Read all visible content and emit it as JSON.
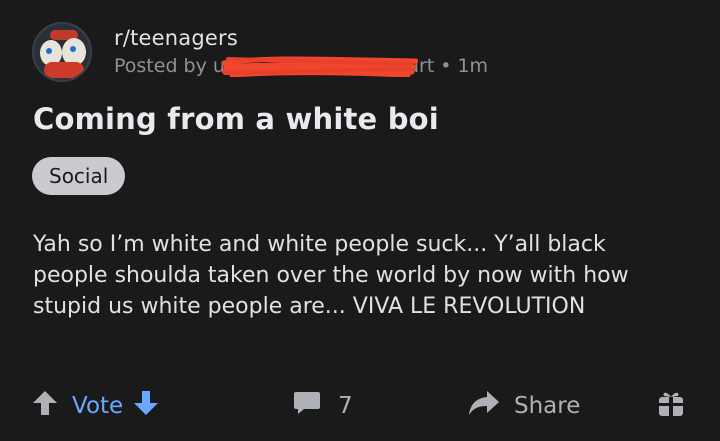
{
  "post": {
    "subreddit": "r/teenagers",
    "posted_prefix": "Posted by u/",
    "posted_suffix": "art",
    "dot": "•",
    "age": "1m",
    "title": "Coming from a white boi",
    "flair": "Social",
    "body": "Yah so I’m white and white people suck... Y’all black people shoulda taken over the world by now with how stupid us white people are... VIVA LE REVOLUTION"
  },
  "actions": {
    "vote_label": "Vote",
    "comment_count": "7",
    "share_label": "Share"
  },
  "icons": {
    "upvote": "arrow-up-icon",
    "downvote": "arrow-down-icon",
    "comment": "comment-bubble-icon",
    "share": "share-arrow-icon",
    "award": "gift-icon"
  },
  "colors": {
    "background": "#1a1a1b",
    "vote_accent": "#6aa9ff",
    "redaction": "#f0462d"
  }
}
